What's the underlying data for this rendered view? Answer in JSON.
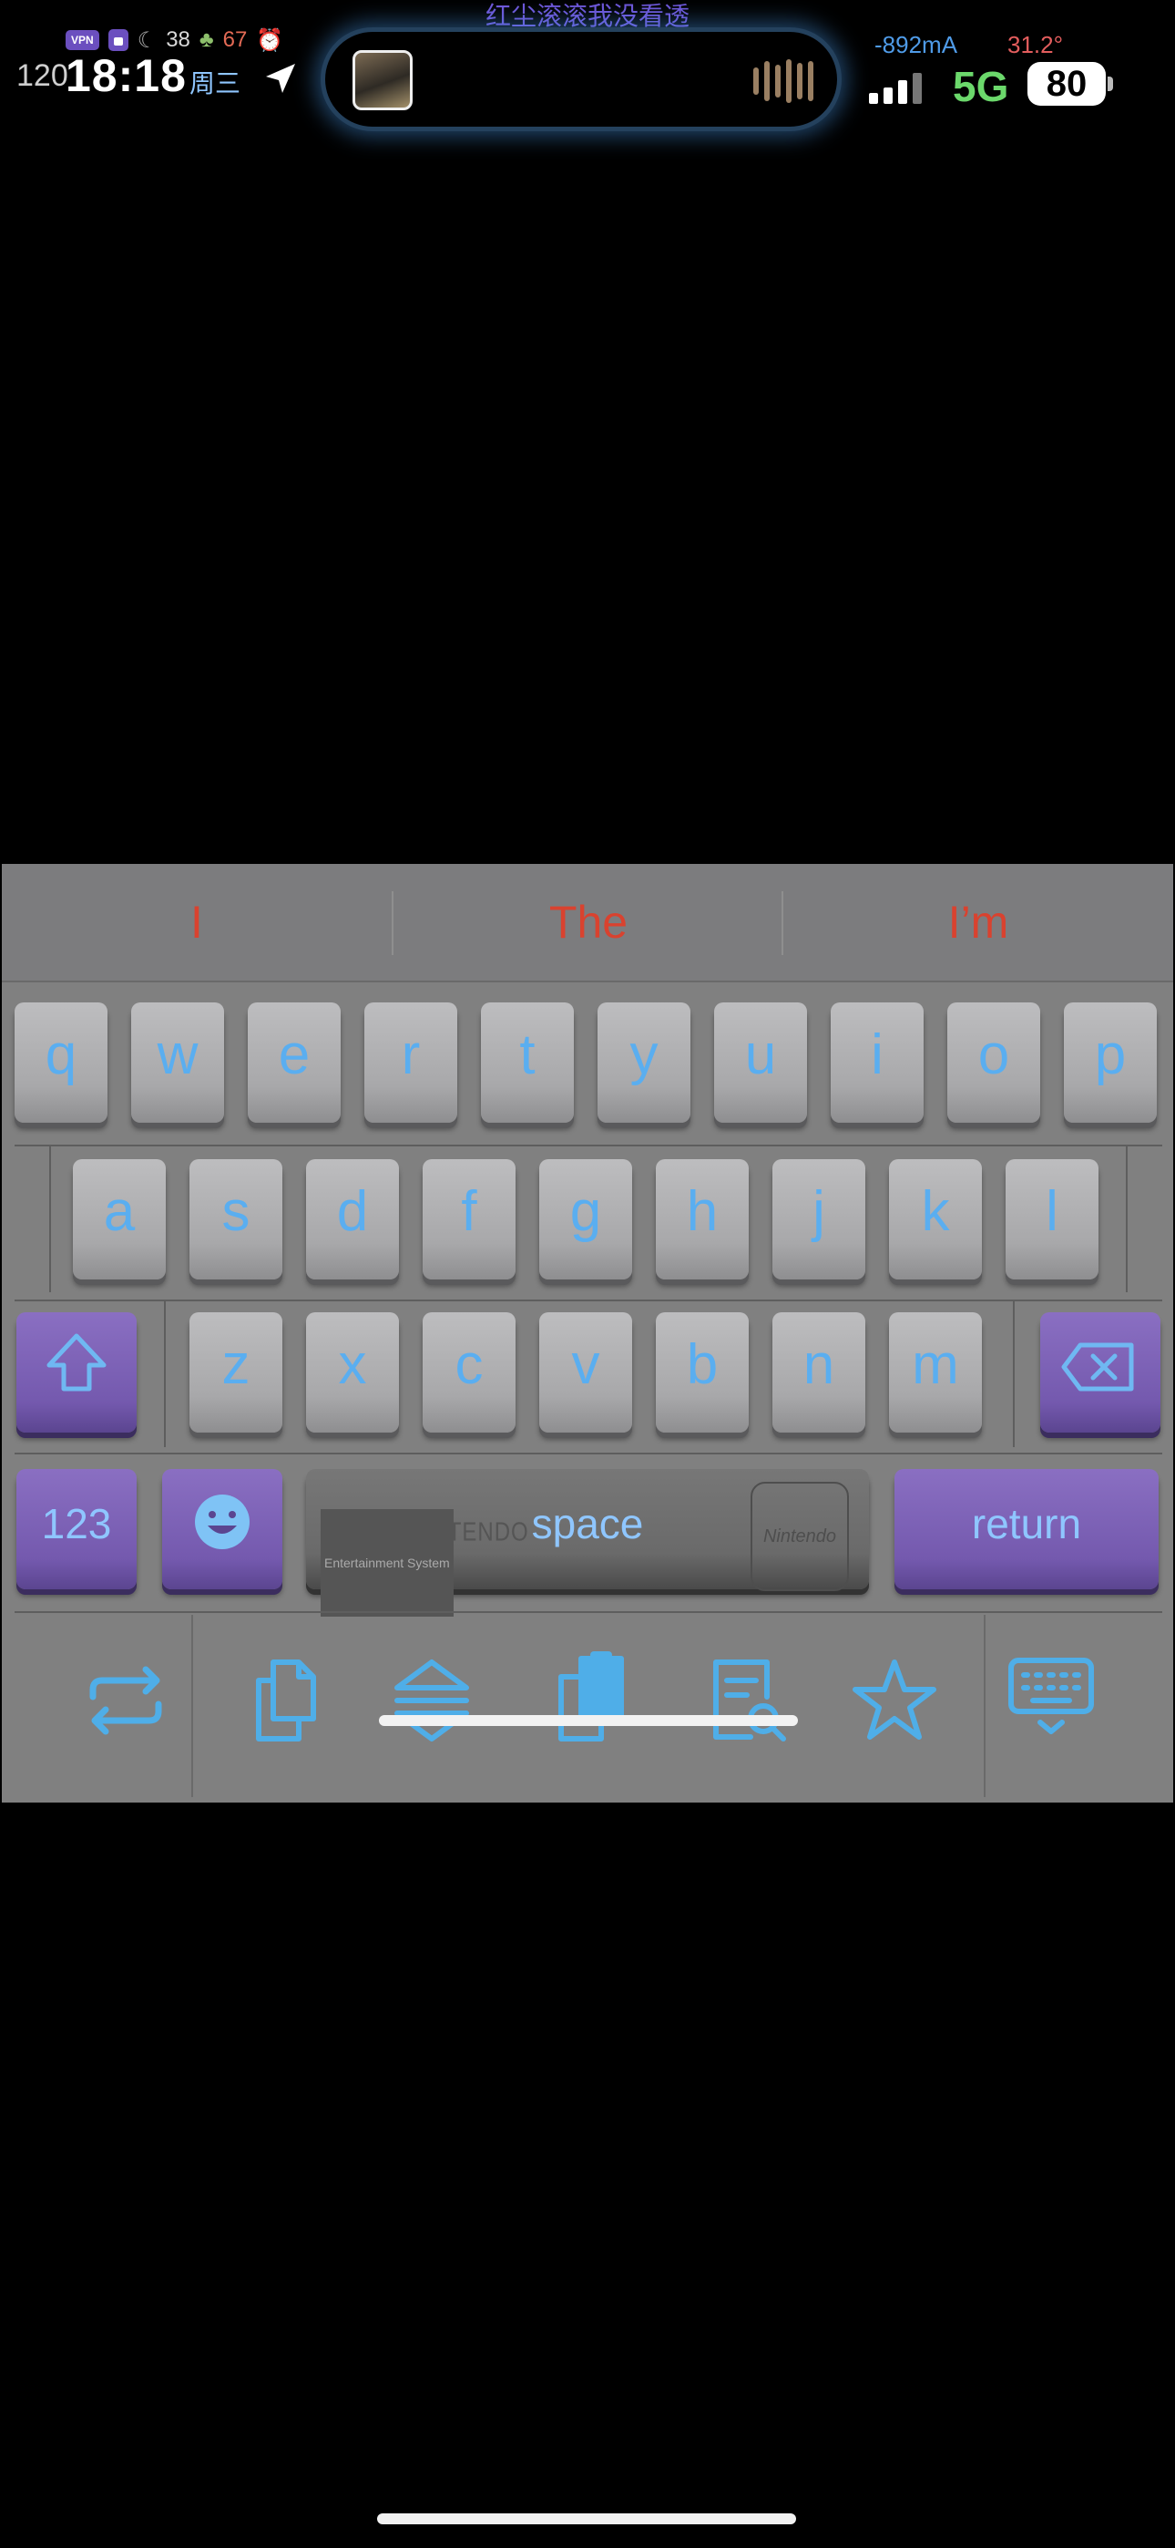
{
  "status_bar": {
    "vpn": "VPN",
    "cpu_temp": "38",
    "phone_temp": "67",
    "refresh_rate": "120",
    "time": "18:18",
    "weekday": "周三",
    "now_playing": "红尘滚滚我没看透",
    "current": "-892mA",
    "battery_temp": "31.2°",
    "network": "5G",
    "battery": "80",
    "colors": {
      "time": "#ffffff",
      "network": "#6bd86b",
      "current": "#4f9be8",
      "battery_temp": "#e35d5d",
      "island_glow": "#4696e6"
    }
  },
  "suggestions": [
    "I",
    "The",
    "I’m"
  ],
  "keyboard": {
    "row1": [
      "q",
      "w",
      "e",
      "r",
      "t",
      "y",
      "u",
      "i",
      "o",
      "p"
    ],
    "row2": [
      "a",
      "s",
      "d",
      "f",
      "g",
      "h",
      "j",
      "k",
      "l"
    ],
    "row3": [
      "z",
      "x",
      "c",
      "v",
      "b",
      "n",
      "m"
    ],
    "numbers_label": "123",
    "space_label": "space",
    "space_brand": "SUPER NINTENDO",
    "space_brand_sub": "Entertainment System",
    "space_logo": "Nintendo",
    "return_label": "return",
    "shift_icon": "shift-arrow-icon",
    "delete_icon": "backspace-icon",
    "emoji_icon": "emoji-face-icon",
    "colors": {
      "letters": "#5aaef0",
      "function_keys": "#7459ae",
      "suggestions": "#d9422f",
      "keyboard_bg": "#808080"
    }
  },
  "toolbar": {
    "icons": [
      "switch-arrows-icon",
      "copy-icon",
      "expand-collapse-icon",
      "clipboard-paste-icon",
      "search-document-icon",
      "star-icon",
      "hide-keyboard-icon"
    ]
  }
}
